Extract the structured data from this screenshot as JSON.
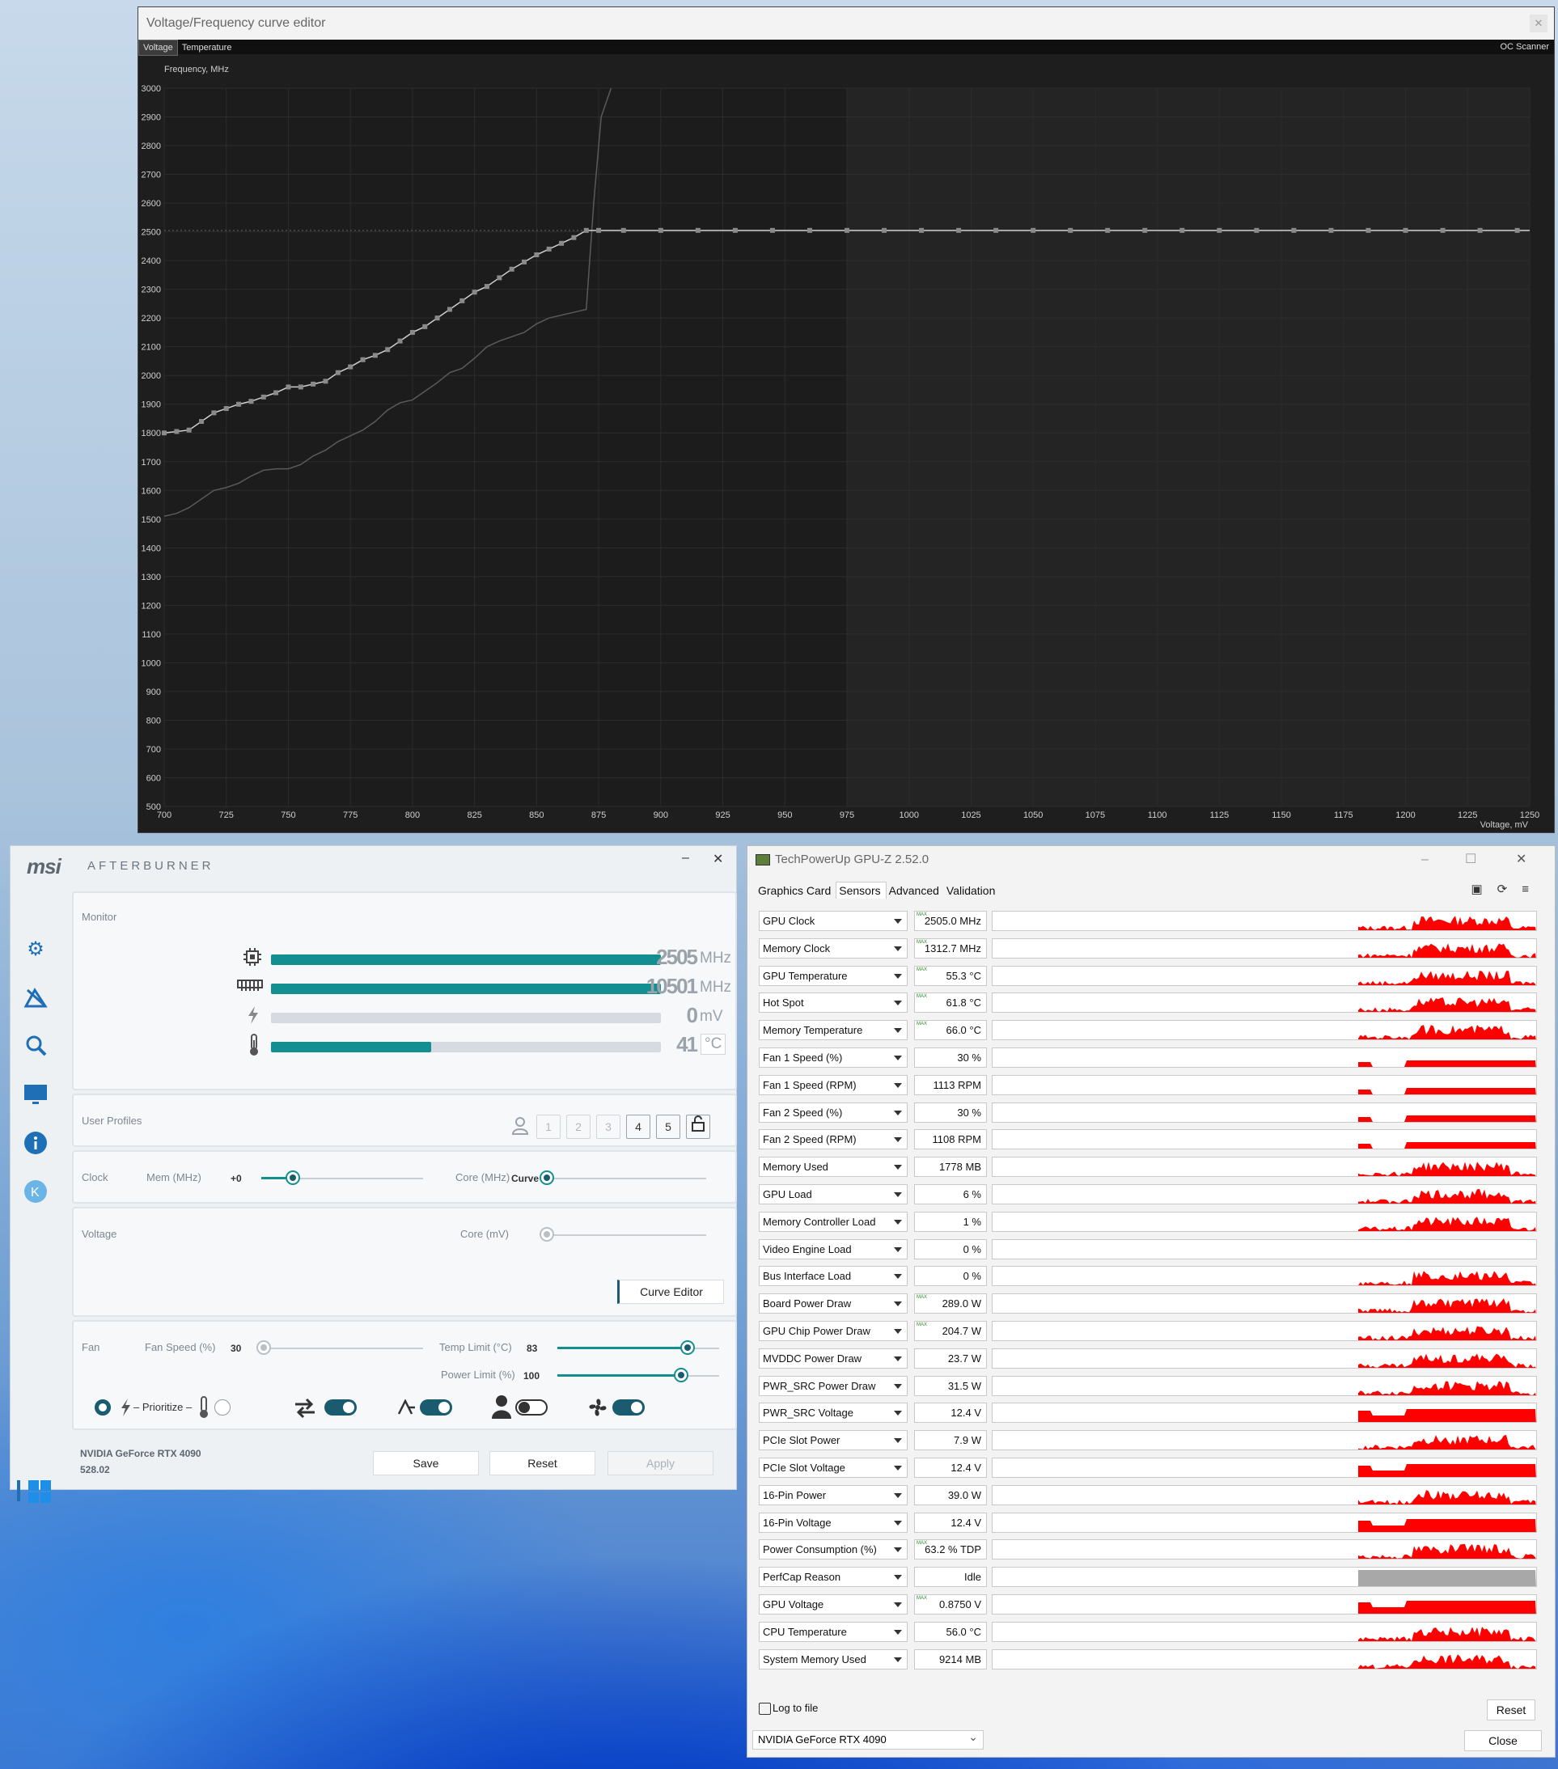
{
  "vf_editor": {
    "title": "Voltage/Frequency curve editor",
    "tabs": [
      "Voltage",
      "Temperature"
    ],
    "oc_scanner": "OC Scanner",
    "y_axis_label": "Frequency, MHz",
    "x_axis_label": "Voltage, mV",
    "chart_data": {
      "type": "line",
      "xlim": [
        700,
        1250
      ],
      "ylim": [
        500,
        3000
      ],
      "x_ticks": [
        700,
        725,
        750,
        775,
        800,
        825,
        850,
        875,
        900,
        925,
        950,
        975,
        1000,
        1025,
        1050,
        1075,
        1100,
        1125,
        1150,
        1175,
        1200,
        1225,
        1250
      ],
      "y_ticks": [
        500,
        600,
        700,
        800,
        900,
        1000,
        1100,
        1200,
        1300,
        1400,
        1500,
        1600,
        1700,
        1800,
        1900,
        2000,
        2100,
        2200,
        2300,
        2400,
        2500,
        2600,
        2700,
        2800,
        2900,
        3000
      ],
      "series": [
        {
          "values_x": [
            700,
            705,
            710,
            715,
            720,
            725,
            730,
            735,
            740,
            745,
            750,
            755,
            760,
            765,
            770,
            775,
            780,
            785,
            790,
            795,
            800,
            805,
            810,
            815,
            820,
            825,
            830,
            835,
            840,
            845,
            850,
            855,
            860,
            865,
            870,
            875,
            1250
          ],
          "values_y": [
            1800,
            1805,
            1810,
            1840,
            1870,
            1885,
            1900,
            1910,
            1925,
            1940,
            1960,
            1960,
            1970,
            1980,
            2010,
            2030,
            2055,
            2070,
            2090,
            2120,
            2150,
            2170,
            2200,
            2230,
            2260,
            2290,
            2310,
            2340,
            2370,
            2395,
            2420,
            2440,
            2460,
            2480,
            2505,
            2505,
            2505
          ]
        },
        {
          "values_x": [
            700,
            705,
            710,
            715,
            720,
            725,
            730,
            735,
            740,
            745,
            750,
            755,
            760,
            765,
            770,
            775,
            780,
            785,
            790,
            795,
            800,
            805,
            810,
            815,
            820,
            825,
            830,
            835,
            840,
            845,
            850,
            855,
            860,
            865,
            870,
            873,
            876,
            880
          ],
          "values_y": [
            1510,
            1520,
            1540,
            1570,
            1600,
            1610,
            1625,
            1650,
            1670,
            1675,
            1675,
            1690,
            1720,
            1740,
            1770,
            1790,
            1810,
            1840,
            1880,
            1905,
            1915,
            1945,
            1975,
            2010,
            2025,
            2060,
            2100,
            2120,
            2135,
            2150,
            2180,
            2200,
            2210,
            2220,
            2230,
            2600,
            2900,
            3000
          ]
        }
      ],
      "highlight_from_x": 975
    }
  },
  "afterburner": {
    "logo": "msi",
    "brand": "AFTERBURNER",
    "minimize": "–",
    "close": "✕",
    "monitor": {
      "label": "Monitor",
      "rows": [
        {
          "value": "2505",
          "unit": "MHz",
          "fill": 1.0
        },
        {
          "value": "10501",
          "unit": "MHz",
          "fill": 1.0
        },
        {
          "value": "0",
          "unit": "mV",
          "fill": 0.0
        },
        {
          "value": "41",
          "unit": "°C",
          "fill": 0.41
        }
      ]
    },
    "profiles": {
      "label": "User Profiles",
      "slots": [
        "1",
        "2",
        "3",
        "4",
        "5"
      ]
    },
    "clock": {
      "label": "Clock",
      "mem_label": "Mem (MHz)",
      "mem_value": "+0",
      "core_label": "Core (MHz)",
      "core_value": "Curve"
    },
    "voltage": {
      "label": "Voltage",
      "core_label": "Core (mV)",
      "curve_editor": "Curve Editor"
    },
    "fan": {
      "label": "Fan",
      "speed_label": "Fan Speed (%)",
      "speed_value": "30",
      "temp_label": "Temp Limit (°C)",
      "temp_value": "83",
      "power_label": "Power Limit (%)",
      "power_value": "100",
      "prioritize": "– Prioritize –"
    },
    "footer": {
      "gpu": "NVIDIA GeForce RTX 4090",
      "driver": "528.02",
      "save": "Save",
      "reset": "Reset",
      "apply": "Apply"
    }
  },
  "gpuz": {
    "title": "TechPowerUp GPU-Z 2.52.0",
    "tabs": [
      "Graphics Card",
      "Sensors",
      "Advanced",
      "Validation"
    ],
    "sensors": [
      {
        "name": "GPU Clock",
        "value": "2505.0 MHz",
        "max": true
      },
      {
        "name": "Memory Clock",
        "value": "1312.7 MHz",
        "max": true
      },
      {
        "name": "GPU Temperature",
        "value": "55.3 °C",
        "max": true
      },
      {
        "name": "Hot Spot",
        "value": "61.8 °C",
        "max": true
      },
      {
        "name": "Memory Temperature",
        "value": "66.0 °C",
        "max": true
      },
      {
        "name": "Fan 1 Speed (%)",
        "value": "30 %",
        "max": false
      },
      {
        "name": "Fan 1 Speed (RPM)",
        "value": "1113 RPM",
        "max": false
      },
      {
        "name": "Fan 2 Speed (%)",
        "value": "30 %",
        "max": false
      },
      {
        "name": "Fan 2 Speed (RPM)",
        "value": "1108 RPM",
        "max": false
      },
      {
        "name": "Memory Used",
        "value": "1778 MB",
        "max": false
      },
      {
        "name": "GPU Load",
        "value": "6 %",
        "max": false
      },
      {
        "name": "Memory Controller Load",
        "value": "1 %",
        "max": false
      },
      {
        "name": "Video Engine Load",
        "value": "0 %",
        "max": false
      },
      {
        "name": "Bus Interface Load",
        "value": "0 %",
        "max": false
      },
      {
        "name": "Board Power Draw",
        "value": "289.0 W",
        "max": true
      },
      {
        "name": "GPU Chip Power Draw",
        "value": "204.7 W",
        "max": true
      },
      {
        "name": "MVDDC Power Draw",
        "value": "23.7 W",
        "max": false
      },
      {
        "name": "PWR_SRC Power Draw",
        "value": "31.5 W",
        "max": false
      },
      {
        "name": "PWR_SRC Voltage",
        "value": "12.4 V",
        "max": false
      },
      {
        "name": "PCIe Slot Power",
        "value": "7.9 W",
        "max": false
      },
      {
        "name": "PCIe Slot Voltage",
        "value": "12.4 V",
        "max": false
      },
      {
        "name": "16-Pin Power",
        "value": "39.0 W",
        "max": false
      },
      {
        "name": "16-Pin Voltage",
        "value": "12.4 V",
        "max": false
      },
      {
        "name": "Power Consumption (%)",
        "value": "63.2 % TDP",
        "max": true
      },
      {
        "name": "PerfCap Reason",
        "value": "Idle",
        "max": false
      },
      {
        "name": "GPU Voltage",
        "value": "0.8750 V",
        "max": true
      },
      {
        "name": "CPU Temperature",
        "value": "56.0 °C",
        "max": false
      },
      {
        "name": "System Memory Used",
        "value": "9214 MB",
        "max": false
      }
    ],
    "max_tag": "MAX",
    "log_to_file": "Log to file",
    "reset": "Reset",
    "close": "Close",
    "device": "NVIDIA GeForce RTX 4090"
  }
}
